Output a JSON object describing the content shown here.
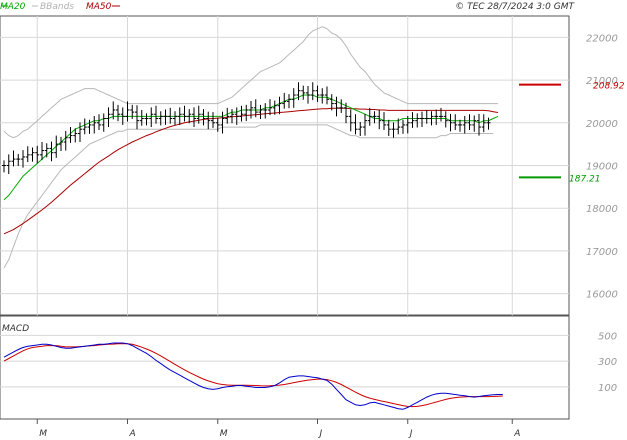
{
  "header": {
    "legend_ma20": "MA20",
    "legend_bbands": "BBands",
    "legend_ma50": "MA50",
    "timestamp": "© TEC 28/7/2024 3:0 GMT"
  },
  "macd_label": "MACD",
  "levels": {
    "resistance": {
      "value": 208.92,
      "label": "208.92"
    },
    "support": {
      "value": 187.21,
      "label": "187.21"
    }
  },
  "colors": {
    "ma20": "#00aa00",
    "ma50": "#aa0000",
    "bbands": "#b8b8b8",
    "price": "#000000",
    "macd": "#0000cc",
    "signal": "#cc0000",
    "grid": "#d8d8d8",
    "resistance": "#cc0000",
    "support": "#009900"
  },
  "chart_data": [
    {
      "type": "ohlc",
      "title": "",
      "y_axis_ticks": [
        "16000",
        "17000",
        "18000",
        "19000",
        "20000",
        "21000",
        "22000"
      ],
      "x_axis_labels": [
        "M",
        "A",
        "M",
        "J",
        "J",
        "A"
      ],
      "ylim": [
        155,
        225
      ],
      "xlim": [
        0,
        108
      ],
      "grid": true,
      "legend": "top-left",
      "month_starts": [
        7,
        26,
        45,
        66,
        85,
        107
      ],
      "price_close": [
        190,
        191,
        191.5,
        191.5,
        192,
        192.5,
        193,
        192.5,
        193.5,
        194,
        193,
        195,
        195.5,
        196.5,
        197,
        197.5,
        198.5,
        199,
        199.5,
        200,
        199.5,
        201,
        202,
        203,
        202,
        201.5,
        203,
        202.5,
        200.5,
        201,
        201,
        202,
        201,
        201.5,
        201.5,
        201,
        201.5,
        202,
        201.5,
        202,
        201,
        202,
        201,
        200.5,
        200,
        199.5,
        201,
        201.5,
        202,
        201.5,
        202,
        203,
        203.5,
        202.5,
        203,
        203,
        203.5,
        204,
        204.5,
        205,
        205.5,
        206.5,
        207.5,
        207,
        206.5,
        207.5,
        206.5,
        206.5,
        205.5,
        204.5,
        203.5,
        203.5,
        201.5,
        200,
        198.5,
        199,
        200.5,
        201.5,
        201.5,
        200.5,
        199.5,
        198.5,
        198.5,
        199,
        199.5,
        200,
        200.5,
        201,
        201,
        201,
        201.5,
        201.5,
        201.5,
        200.5,
        200,
        199.5,
        199.5,
        200,
        199.5,
        200.5,
        199,
        200,
        200
      ],
      "series": [
        {
          "name": "MA20",
          "values": [
            182,
            183,
            184.5,
            186,
            187.5,
            188.5,
            189.5,
            190.5,
            191.5,
            192.5,
            193.5,
            194.5,
            195.5,
            196.5,
            197.5,
            198.5,
            199,
            199.5,
            200,
            200.5,
            200.5,
            201,
            201,
            201.5,
            201.5,
            201.5,
            201.5,
            201.5,
            201.5,
            201.5,
            201.5,
            201.5,
            201.5,
            201.5,
            201.5,
            201.5,
            201.5,
            201.5,
            201.5,
            201.5,
            201.5,
            201.5,
            201.5,
            201.5,
            201.5,
            201.5,
            201.5,
            202,
            202.5,
            202.5,
            203,
            203,
            203,
            203,
            203,
            203.5,
            203.5,
            204,
            204.5,
            205,
            205.5,
            205.5,
            206,
            206.5,
            206.5,
            206.5,
            206,
            206,
            206,
            205.5,
            205,
            204.5,
            204,
            203.5,
            203,
            202.5,
            202,
            201.5,
            201,
            201,
            200.5,
            200.5,
            200.5,
            200.5,
            201,
            201,
            201,
            201,
            201,
            201,
            201,
            201,
            201,
            201,
            200.5,
            200.5,
            200.5,
            200.5,
            200.5,
            200.5,
            200,
            200.5,
            200.5,
            201,
            201.5
          ]
        },
        {
          "name": "MA50",
          "values": [
            174,
            174.5,
            175,
            175.7,
            176.4,
            177.2,
            178,
            178.8,
            179.6,
            180.5,
            181.4,
            182.4,
            183.4,
            184.4,
            185.4,
            186.3,
            187.2,
            188.1,
            189,
            189.9,
            190.8,
            191.5,
            192.2,
            193,
            193.7,
            194.3,
            194.9,
            195.5,
            196,
            196.5,
            197,
            197.4,
            197.9,
            198.3,
            198.7,
            199.1,
            199.4,
            199.7,
            200,
            200.2,
            200.4,
            200.6,
            200.8,
            200.9,
            201,
            201.1,
            201.2,
            201.3,
            201.4,
            201.5,
            201.6,
            201.7,
            201.8,
            201.9,
            202,
            202.1,
            202.2,
            202.3,
            202.4,
            202.5,
            202.6,
            202.7,
            202.8,
            202.9,
            203,
            203.1,
            203.2,
            203.3,
            203.3,
            203.4,
            203.4,
            203.4,
            203.4,
            203.3,
            203.3,
            203.2,
            203.2,
            203.1,
            203.1,
            203,
            203,
            202.9,
            202.9,
            202.9,
            202.9,
            202.9,
            202.9,
            202.9,
            202.9,
            202.9,
            202.9,
            202.9,
            202.9,
            202.9,
            202.9,
            202.9,
            202.9,
            202.9,
            202.9,
            202.9,
            202.9,
            202.9,
            202.8,
            202.6,
            202.4
          ]
        },
        {
          "name": "BBands",
          "upper": [
            198,
            197,
            196.5,
            197,
            198,
            198.5,
            199.5,
            200.5,
            201.5,
            202.5,
            203.5,
            204.5,
            205.5,
            206,
            206.5,
            207,
            207.5,
            208,
            208,
            208,
            207.5,
            207,
            206.5,
            206,
            205.5,
            205,
            204.5,
            204.5,
            204.5,
            204.5,
            204.5,
            204.5,
            204.5,
            204.5,
            204.5,
            204.5,
            204.5,
            204.5,
            204.5,
            204.5,
            204.5,
            204.5,
            204.5,
            204.5,
            204.5,
            204.5,
            205,
            205.5,
            206,
            207,
            208,
            209,
            210,
            211,
            212,
            212.5,
            213,
            213.5,
            214,
            215,
            216,
            217,
            218,
            219,
            220.5,
            221.5,
            222,
            222.5,
            222,
            221,
            220.5,
            219.5,
            218,
            216,
            214.5,
            213,
            212,
            210.5,
            209,
            208,
            207,
            206.5,
            206,
            205.5,
            205,
            204.5,
            204.5,
            204.5,
            204.5,
            204.5,
            204.5,
            204.5,
            204.5,
            204.5,
            204.5,
            204.5,
            204.5,
            204.5,
            204.5,
            204.5,
            204.5,
            204.5,
            204.5,
            204.5,
            204.5
          ],
          "lower": [
            166,
            168,
            171,
            174,
            176.5,
            178.5,
            180,
            181.5,
            183,
            184.5,
            186,
            187.5,
            189,
            190,
            191,
            192,
            193,
            194,
            195,
            195.5,
            196,
            196.5,
            197,
            197.5,
            198,
            198,
            198.5,
            198.5,
            198.5,
            198.5,
            198.5,
            198.5,
            198.5,
            198.5,
            198.5,
            198.5,
            198.5,
            198.5,
            198.5,
            198.5,
            198.5,
            198.5,
            198.5,
            198.5,
            198.5,
            198.5,
            199,
            199,
            199,
            199,
            199,
            199,
            199,
            199,
            199.5,
            199.5,
            199.5,
            199.5,
            199.5,
            199.5,
            199.5,
            199.5,
            199.5,
            199.5,
            199.5,
            199.5,
            199.5,
            199.5,
            199.5,
            199,
            198.5,
            198,
            197.5,
            197,
            197,
            196.5,
            196.5,
            196.5,
            196.5,
            196.5,
            196.5,
            196.5,
            196.5,
            196.5,
            196.5,
            196.5,
            196.5,
            196.5,
            196.5,
            196.5,
            196.5,
            196.5,
            197,
            197,
            197.5,
            197.5,
            197.5,
            197.5,
            197.5,
            197.5,
            197.5,
            197.5,
            197.5,
            197.5
          ]
        }
      ]
    },
    {
      "type": "line",
      "title": "MACD",
      "y_axis_ticks": [
        "100",
        "300",
        "500"
      ],
      "ylim": [
        -150,
        650
      ],
      "xlim": [
        0,
        108
      ],
      "grid": true,
      "series": [
        {
          "name": "MACD",
          "values": [
            330,
            350,
            370,
            390,
            405,
            415,
            420,
            425,
            430,
            430,
            425,
            415,
            405,
            400,
            400,
            405,
            410,
            415,
            420,
            425,
            430,
            430,
            435,
            440,
            440,
            440,
            435,
            420,
            400,
            380,
            360,
            335,
            305,
            280,
            255,
            230,
            210,
            190,
            170,
            150,
            130,
            110,
            95,
            85,
            80,
            85,
            95,
            100,
            105,
            110,
            110,
            105,
            100,
            95,
            95,
            95,
            100,
            110,
            130,
            155,
            175,
            180,
            185,
            185,
            180,
            175,
            170,
            160,
            150,
            120,
            80,
            40,
            0,
            -20,
            -40,
            -45,
            -40,
            -25,
            -20,
            -30,
            -40,
            -50,
            -60,
            -70,
            -75,
            -60,
            -40,
            -20,
            0,
            20,
            35,
            45,
            50,
            50,
            45,
            40,
            35,
            30,
            25,
            20,
            25,
            30,
            35,
            38,
            40,
            40
          ]
        },
        {
          "name": "Signal",
          "values": [
            300,
            320,
            340,
            360,
            380,
            395,
            405,
            410,
            415,
            420,
            420,
            420,
            415,
            410,
            410,
            410,
            412,
            415,
            418,
            420,
            425,
            428,
            430,
            432,
            435,
            436,
            435,
            430,
            420,
            408,
            394,
            378,
            360,
            340,
            318,
            296,
            274,
            252,
            232,
            212,
            194,
            176,
            160,
            146,
            134,
            124,
            118,
            114,
            112,
            112,
            112,
            112,
            111,
            110,
            108,
            107,
            108,
            110,
            113,
            118,
            125,
            133,
            140,
            146,
            152,
            156,
            160,
            160,
            156,
            147,
            134,
            118,
            98,
            78,
            58,
            40,
            24,
            12,
            2,
            -6,
            -14,
            -22,
            -30,
            -38,
            -46,
            -52,
            -54,
            -52,
            -46,
            -38,
            -28,
            -18,
            -8,
            2,
            10,
            16,
            20,
            22,
            24,
            24,
            24,
            24,
            24,
            25,
            27,
            29
          ]
        }
      ]
    }
  ]
}
